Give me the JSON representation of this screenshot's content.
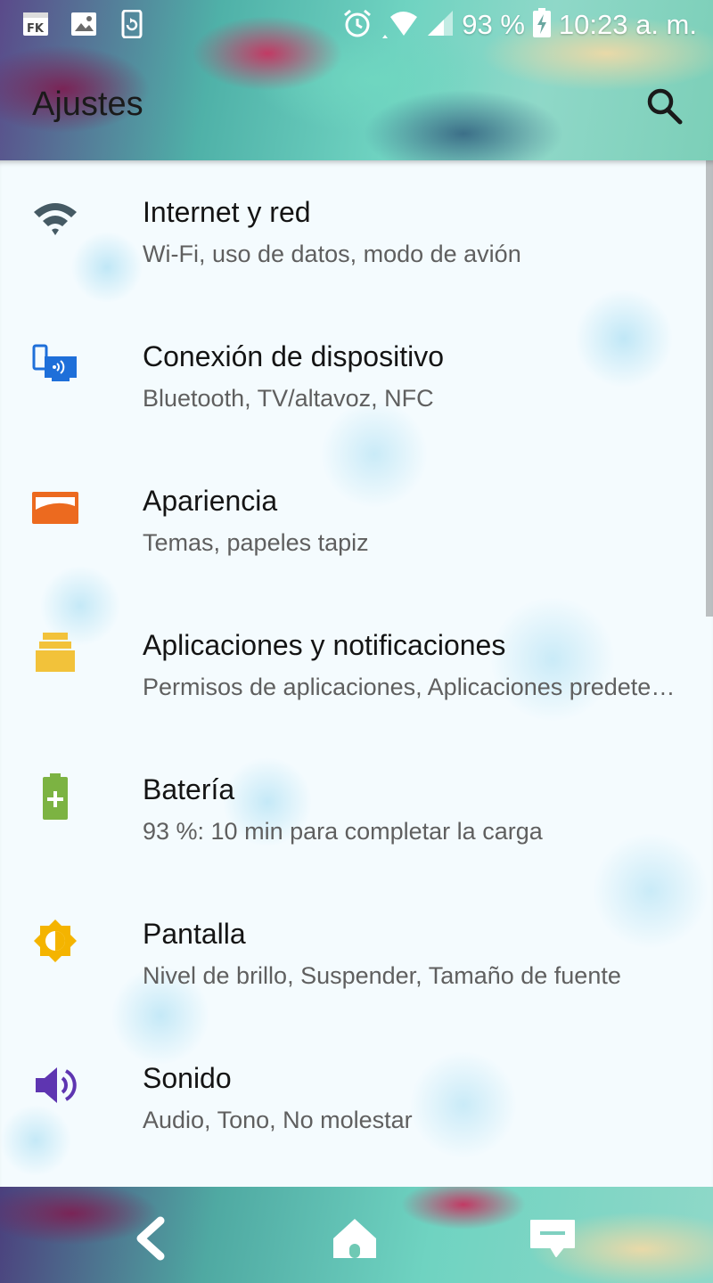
{
  "status_bar": {
    "battery": "93 %",
    "time": "10:23 a. m.",
    "icons": [
      "fk-notification-icon",
      "image-notification-icon",
      "phone-sync-icon",
      "alarm-icon",
      "wifi-icon",
      "signal-icon",
      "battery-charging-icon"
    ]
  },
  "header": {
    "title": "Ajustes",
    "search_icon": "search-icon"
  },
  "settings": [
    {
      "icon": "wifi-icon",
      "color": "#455a64",
      "title": "Internet y red",
      "subtitle": "Wi-Fi, uso de datos, modo de avión"
    },
    {
      "icon": "device-connection-icon",
      "color": "#1e6fd9",
      "title": "Conexión de dispositivo",
      "subtitle": "Bluetooth, TV/altavoz, NFC"
    },
    {
      "icon": "appearance-icon",
      "color": "#ec6a1f",
      "title": "Apariencia",
      "subtitle": "Temas, papeles tapiz"
    },
    {
      "icon": "apps-icon",
      "color": "#f2c23a",
      "title": "Aplicaciones y notificaciones",
      "subtitle": "Permisos de aplicaciones, Aplicaciones predeterminadas"
    },
    {
      "icon": "battery-icon",
      "color": "#7cb342",
      "title": "Batería",
      "subtitle": "93 %: 10 min para completar la carga"
    },
    {
      "icon": "brightness-icon",
      "color": "#f4b400",
      "title": "Pantalla",
      "subtitle": "Nivel de brillo, Suspender, Tamaño de fuente"
    },
    {
      "icon": "volume-icon",
      "color": "#5e35b1",
      "title": "Sonido",
      "subtitle": "Audio, Tono, No molestar"
    }
  ],
  "nav": {
    "back_icon": "back-icon",
    "home_icon": "home-icon",
    "recents_icon": "recents-icon"
  }
}
